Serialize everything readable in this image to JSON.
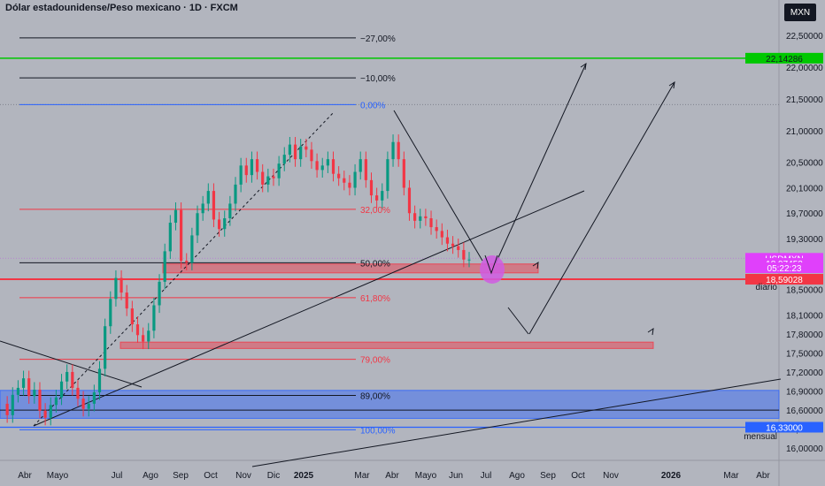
{
  "header": {
    "title": "Dólar estadounidense/Peso mexicano · 1D · FXCM"
  },
  "currency_button": "MXN",
  "chart_data": {
    "type": "line",
    "title": "Dólar estadounidense/Peso mexicano · 1D · FXCM",
    "symbol": "USDMXN",
    "xlabel": "",
    "ylabel": "",
    "x_tick_labels": [
      "Abr",
      "Mayo",
      "Jul",
      "Ago",
      "Sep",
      "Oct",
      "Nov",
      "Dic",
      "2025",
      "Mar",
      "Abr",
      "Mayo",
      "Jun",
      "Jul",
      "Ago",
      "Sep",
      "Oct",
      "Nov",
      "2026",
      "Mar",
      "Abr"
    ],
    "y_tick_labels": [
      "22,50000",
      "22,00000",
      "21,50000",
      "21,00000",
      "20,50000",
      "20,10000",
      "19,70000",
      "19,30000",
      "18,90000",
      "18,50000",
      "18,10000",
      "17,80000",
      "17,50000",
      "17,20000",
      "16,90000",
      "16,60000",
      "16,30000",
      "16,00000"
    ],
    "ylim": [
      15.85,
      22.75
    ],
    "grid": false,
    "series": [
      {
        "values": [
          16.7,
          16.52,
          16.84,
          16.95,
          17.1,
          16.82,
          16.92,
          16.59,
          16.48,
          16.68,
          16.8,
          17.05,
          17.2,
          16.95,
          16.78,
          16.62,
          16.7,
          16.88,
          17.25,
          17.92,
          18.35,
          18.68,
          18.45,
          18.2,
          17.95,
          17.78,
          17.68,
          17.85,
          18.25,
          18.62,
          19.1,
          19.55,
          19.75,
          18.95,
          18.92,
          19.35,
          19.7,
          19.85,
          20.05,
          19.6,
          19.45,
          19.62,
          19.85,
          20.15,
          20.45,
          20.3,
          20.55,
          20.35,
          20.15,
          20.28,
          20.25,
          20.48,
          20.62,
          20.78,
          20.55,
          20.75,
          20.7,
          20.52,
          20.38,
          20.45,
          20.55,
          20.32,
          20.25,
          20.18,
          20.1,
          20.35,
          20.55,
          20.22,
          19.98,
          19.9,
          20.05,
          20.55,
          20.82,
          20.55,
          20.1,
          19.7,
          19.58,
          19.65,
          19.62,
          19.48,
          19.42,
          19.32,
          19.22,
          19.18,
          19.12,
          18.97,
          18.97
        ]
      }
    ],
    "fib_levels": [
      {
        "label": "−27,00%",
        "value": 22.46,
        "color": "#131722"
      },
      {
        "label": "−10,00%",
        "value": 21.83,
        "color": "#131722"
      },
      {
        "label": "0,00%",
        "value": 21.41,
        "color": "#2962ff"
      },
      {
        "label": "32,00%",
        "value": 19.76,
        "color": "#f23645"
      },
      {
        "label": "50,00%",
        "value": 18.92,
        "color": "#131722"
      },
      {
        "label": "61,80%",
        "value": 18.37,
        "color": "#f23645"
      },
      {
        "label": "79,00%",
        "value": 17.4,
        "color": "#f23645"
      },
      {
        "label": "89,00%",
        "value": 16.83,
        "color": "#131722"
      },
      {
        "label": "100,00%",
        "value": 16.29,
        "color": "#2962ff"
      }
    ],
    "zones": [
      {
        "from": 18.76,
        "to": 18.9,
        "color": "#f23645"
      },
      {
        "from": 17.57,
        "to": 17.67,
        "color": "#f23645"
      },
      {
        "from": 16.47,
        "to": 16.91,
        "color": "#2962ff"
      }
    ],
    "price_tags": [
      {
        "label": "22,14286",
        "value": 22.14,
        "color": "#00c800",
        "text_color": "#131722"
      },
      {
        "label": "USDMXN",
        "value": 18.99,
        "color": "#e040fb",
        "text_color": "#ffffff"
      },
      {
        "label": "18,97452",
        "value": 18.91,
        "color": "#e040fb",
        "text_color": "#ffffff"
      },
      {
        "label": "05:22:23",
        "value": 18.84,
        "color": "#e040fb",
        "text_color": "#ffffff"
      },
      {
        "label": "18,59028",
        "value": 18.66,
        "color": "#f23645",
        "text_color": "#ffffff"
      },
      {
        "label": "16,33000",
        "value": 16.33,
        "color": "#2962ff",
        "text_color": "#ffffff"
      }
    ],
    "annotations": [
      {
        "text": "diario",
        "value": 18.55
      },
      {
        "text": "mensual",
        "value": 16.2
      }
    ],
    "colors": {
      "up": "#089981",
      "down": "#f23645",
      "background": "#b2b5be"
    }
  }
}
